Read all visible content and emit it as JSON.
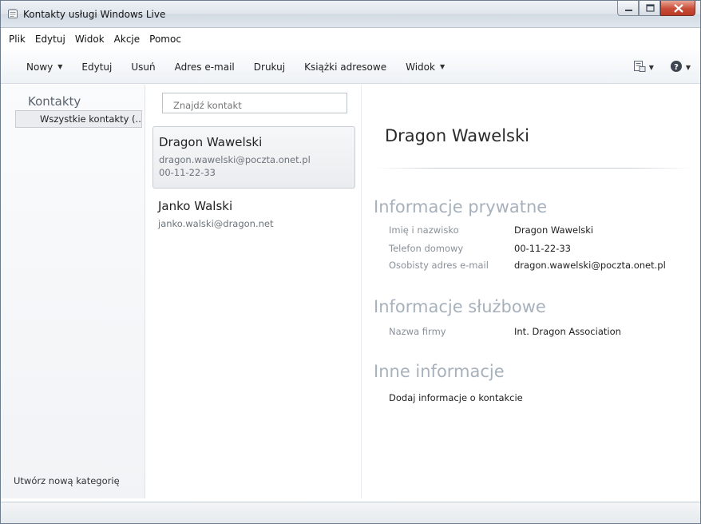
{
  "window": {
    "title": "Kontakty usługi Windows Live"
  },
  "menubar": {
    "items": [
      "Plik",
      "Edytuj",
      "Widok",
      "Akcje",
      "Pomoc"
    ]
  },
  "toolbar": {
    "items": [
      {
        "label": "Nowy",
        "dropdown": true
      },
      {
        "label": "Edytuj",
        "dropdown": false
      },
      {
        "label": "Usuń",
        "dropdown": false
      },
      {
        "label": "Adres e-mail",
        "dropdown": false
      },
      {
        "label": "Drukuj",
        "dropdown": false
      },
      {
        "label": "Książki adresowe",
        "dropdown": false
      },
      {
        "label": "Widok",
        "dropdown": true
      }
    ],
    "right_icons": [
      "layout-icon",
      "help-icon"
    ]
  },
  "sidebar": {
    "heading": "Kontakty",
    "selected_item": "Wszystkie kontakty  (..",
    "footer_link": "Utwórz nową kategorię"
  },
  "list": {
    "search_placeholder": "Znajdź kontakt",
    "contacts": [
      {
        "name": "Dragon Wawelski",
        "email": "dragon.wawelski@poczta.onet.pl",
        "phone": "00-11-22-33",
        "selected": true
      },
      {
        "name": "Janko Walski",
        "email": "janko.walski@dragon.net",
        "phone": "",
        "selected": false
      }
    ]
  },
  "detail": {
    "name": "Dragon Wawelski",
    "sections": {
      "private": {
        "title": "Informacje prywatne",
        "fields": [
          {
            "label": "Imię i nazwisko",
            "value": "Dragon Wawelski"
          },
          {
            "label": "Telefon domowy",
            "value": "00-11-22-33"
          },
          {
            "label": "Osobisty adres e-mail",
            "value": "dragon.wawelski@poczta.onet.pl"
          }
        ]
      },
      "business": {
        "title": "Informacje służbowe",
        "fields": [
          {
            "label": "Nazwa firmy",
            "value": "Int. Dragon Association"
          }
        ]
      },
      "other": {
        "title": "Inne informacje",
        "add_link": "Dodaj informacje o kontakcie"
      }
    }
  },
  "colors": {
    "section_title": "#a7b1bc",
    "field_label": "#8a9098",
    "close_button": "#c84d38"
  }
}
